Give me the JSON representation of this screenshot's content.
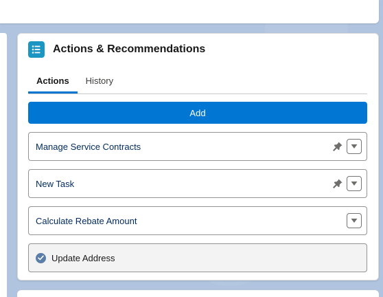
{
  "card": {
    "title": "Actions & Recommendations",
    "icon": "list-icon",
    "accent_color": "#1b96c3"
  },
  "tabs": [
    {
      "label": "Actions",
      "active": true
    },
    {
      "label": "History",
      "active": false
    }
  ],
  "add_button": {
    "label": "Add",
    "color": "#0176d3"
  },
  "actions": [
    {
      "label": "Manage Service Contracts",
      "pinned": true,
      "completed": false
    },
    {
      "label": "New Task",
      "pinned": true,
      "completed": false
    },
    {
      "label": "Calculate Rebate Amount",
      "pinned": false,
      "completed": false
    },
    {
      "label": "Update Address",
      "pinned": false,
      "completed": true
    }
  ]
}
